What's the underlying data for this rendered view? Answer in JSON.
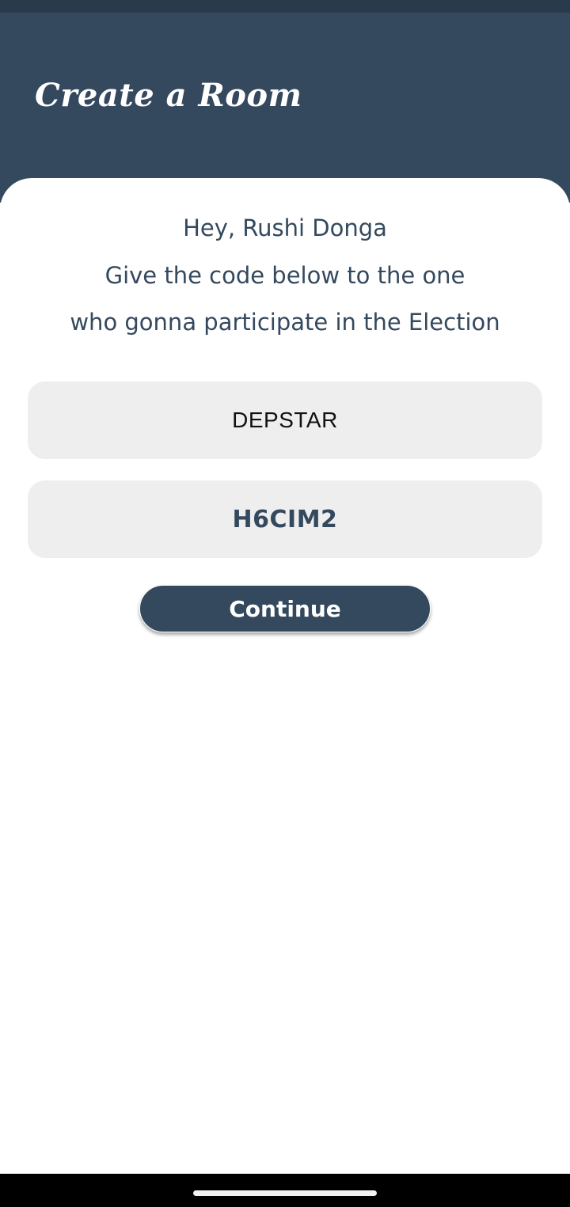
{
  "header": {
    "title": "Create a Room"
  },
  "message": {
    "greeting": "Hey, Rushi Donga",
    "instruction_line1": "Give the code below to the one",
    "instruction_line2": "who gonna participate in the Election"
  },
  "room": {
    "name": "DEPSTAR",
    "code": "H6CIM2"
  },
  "actions": {
    "continue_label": "Continue"
  },
  "colors": {
    "primary": "#34495e",
    "status_bar": "#2a3a4d",
    "field_background": "#eeeeee",
    "card_background": "#ffffff"
  }
}
